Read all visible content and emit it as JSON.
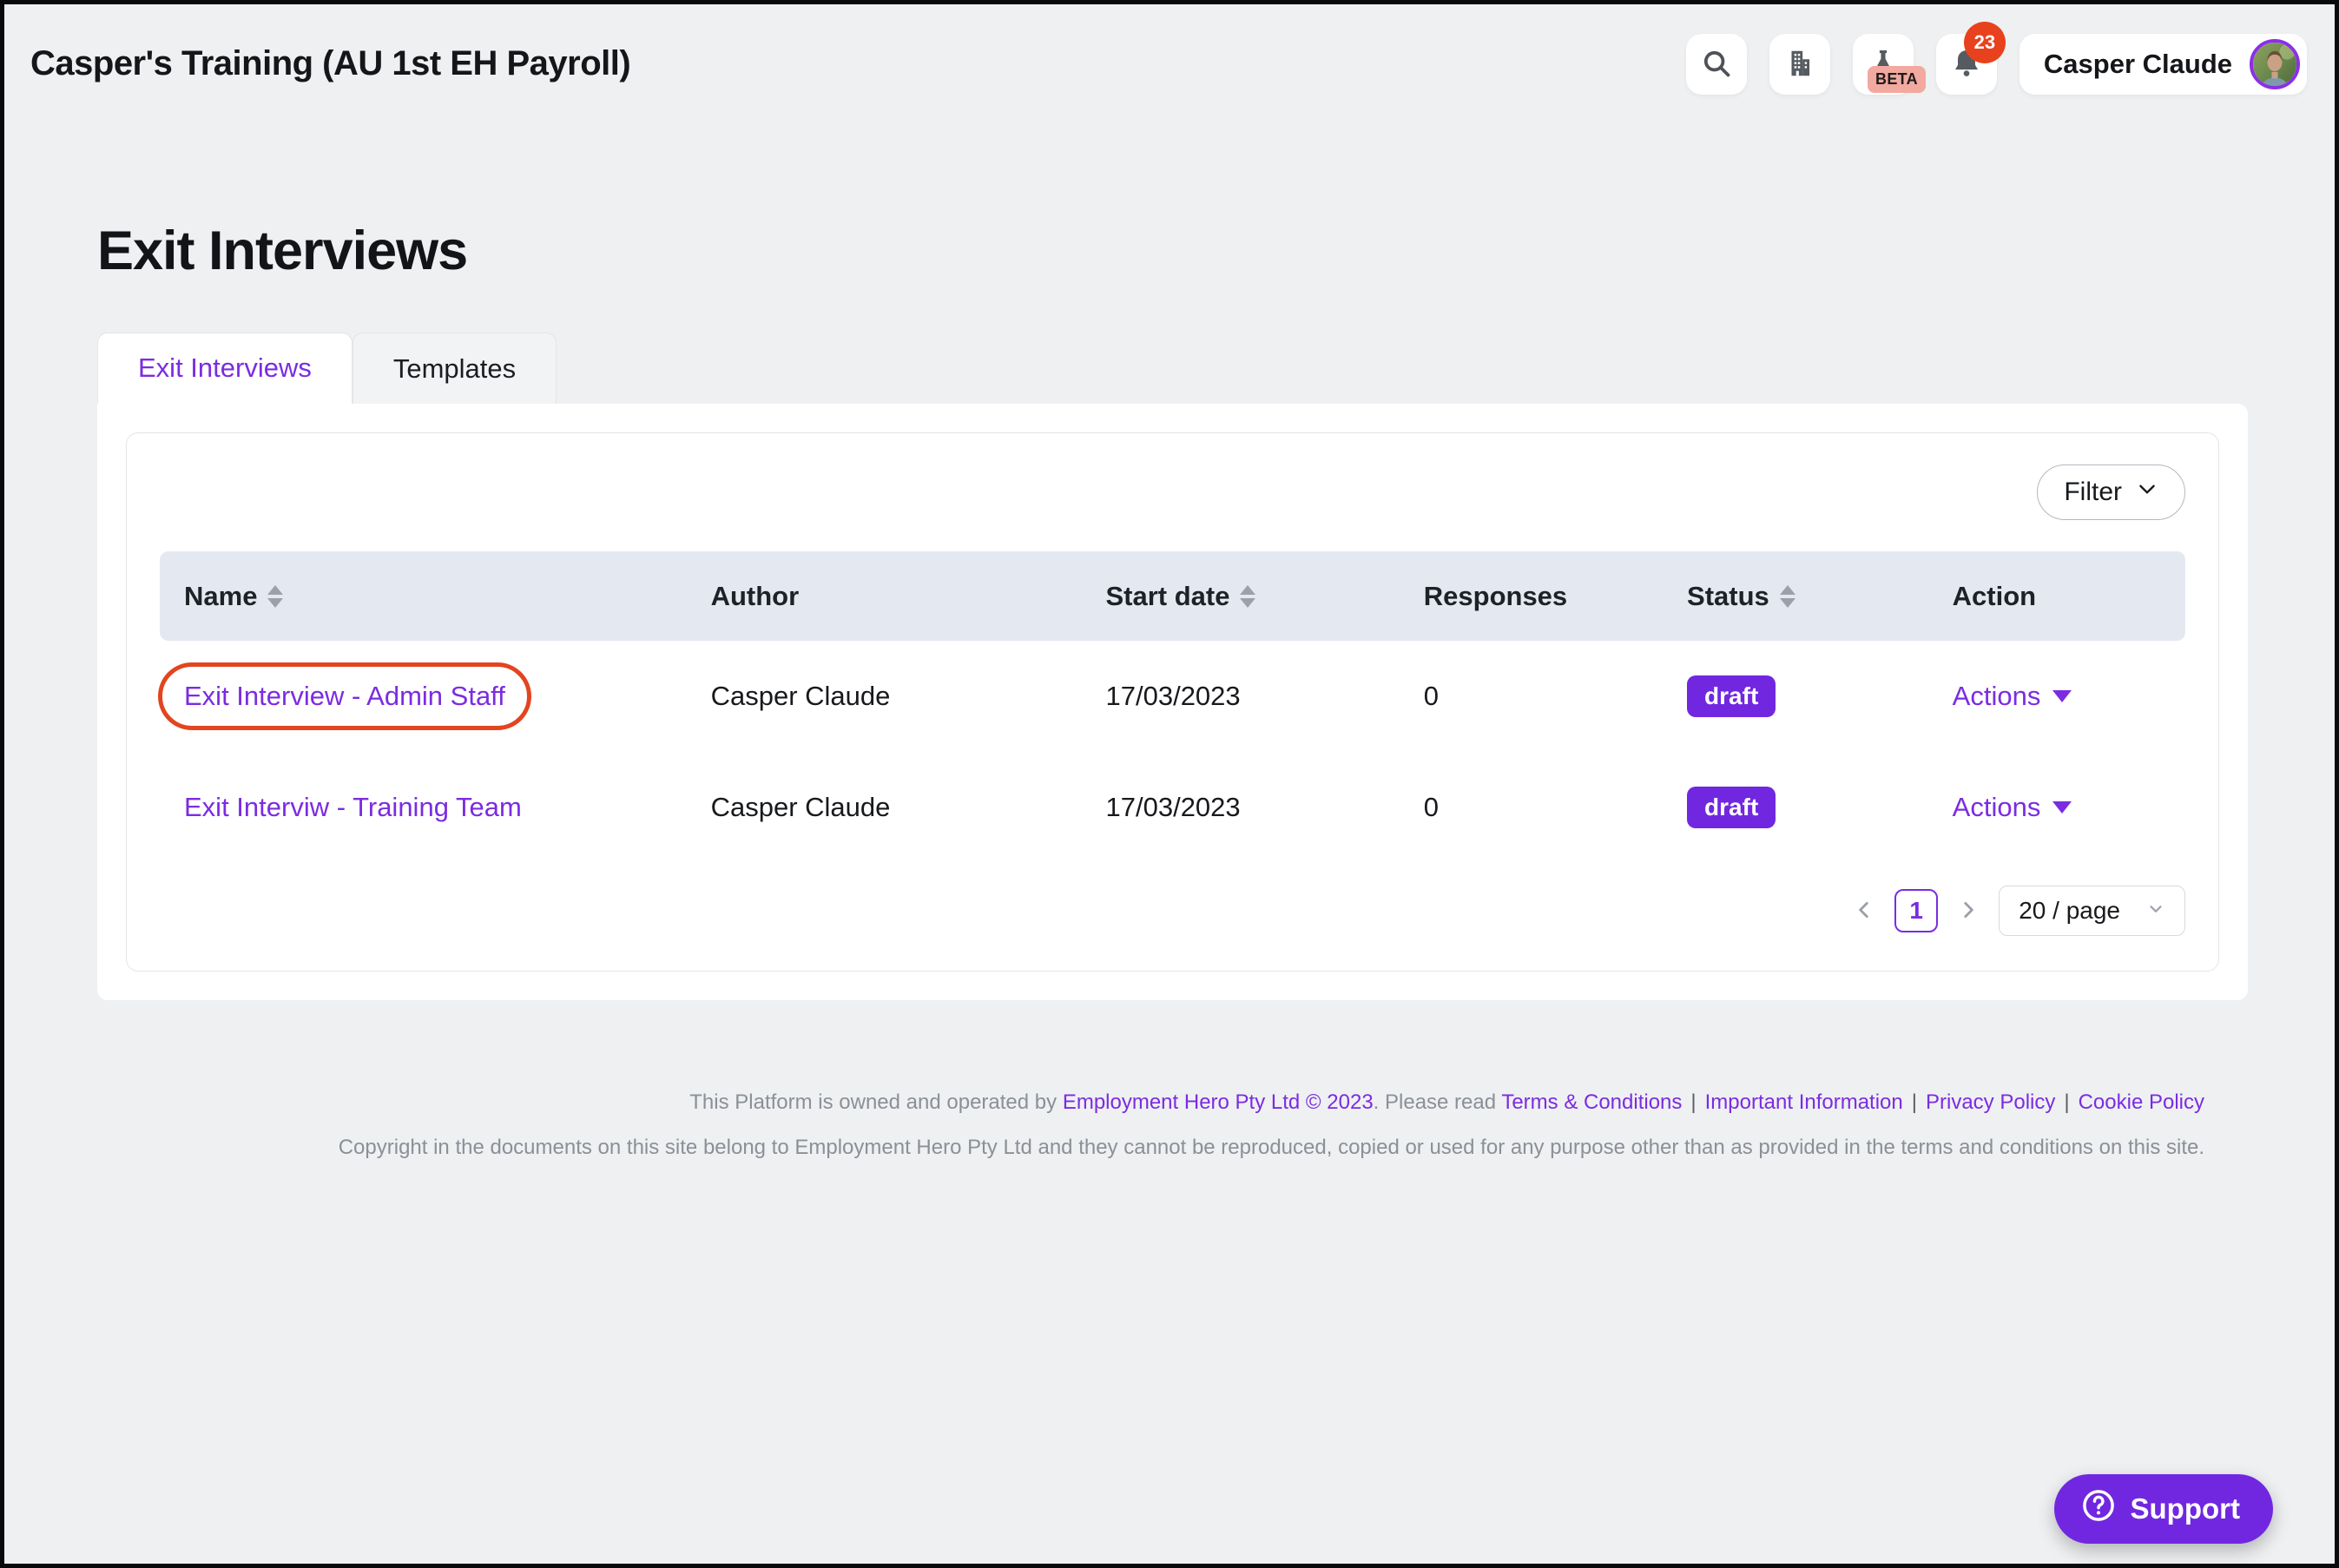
{
  "window": {
    "title": "Casper's Training (AU 1st EH Payroll)"
  },
  "header": {
    "beta_label": "BETA",
    "notification_count": "23",
    "user_name": "Casper Claude"
  },
  "page": {
    "title": "Exit Interviews"
  },
  "tabs": [
    {
      "label": "Exit Interviews",
      "active": true
    },
    {
      "label": "Templates",
      "active": false
    }
  ],
  "toolbar": {
    "filter_label": "Filter"
  },
  "table": {
    "columns": [
      {
        "label": "Name",
        "sortable": true
      },
      {
        "label": "Author",
        "sortable": false
      },
      {
        "label": "Start date",
        "sortable": true
      },
      {
        "label": "Responses",
        "sortable": false
      },
      {
        "label": "Status",
        "sortable": true
      },
      {
        "label": "Action",
        "sortable": false
      }
    ],
    "rows": [
      {
        "name": "Exit Interview - Admin Staff",
        "author": "Casper Claude",
        "start_date": "17/03/2023",
        "responses": "0",
        "status": "draft",
        "action_label": "Actions",
        "annotated": true
      },
      {
        "name": "Exit Interviw - Training Team",
        "author": "Casper Claude",
        "start_date": "17/03/2023",
        "responses": "0",
        "status": "draft",
        "action_label": "Actions",
        "annotated": false
      }
    ]
  },
  "pagination": {
    "current_page": "1",
    "page_size": "20 / page"
  },
  "footer": {
    "line1_prefix": "This Platform is owned and operated by ",
    "company_link": "Employment Hero Pty Ltd © 2023",
    "line1_mid": ". Please read ",
    "terms_link": "Terms & Conditions",
    "important_link": "Important Information",
    "privacy_link": "Privacy Policy",
    "cookie_link": "Cookie Policy",
    "separator": "|",
    "line2": "Copyright in the documents on this site belong to Employment Hero Pty Ltd and they cannot be reproduced, copied or used for any purpose other than as provided in the terms and conditions on this site."
  },
  "support": {
    "label": "Support"
  },
  "colors": {
    "accent_purple": "#7b2ce1",
    "badge_purple": "#7127e0",
    "annotation_red": "#e2451f",
    "notification_red": "#e8411d",
    "beta_pink": "#f2a99f",
    "table_header_bg": "#e4e8f1",
    "page_bg": "#eef0f2"
  }
}
